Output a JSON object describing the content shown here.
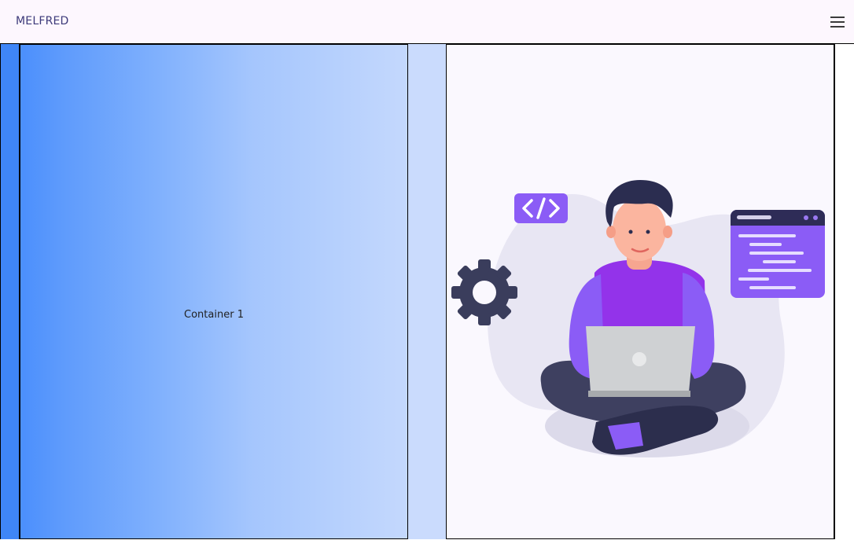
{
  "navbar": {
    "brand": "MELFRED",
    "menu_icon": "hamburger-menu-icon"
  },
  "main": {
    "container1_label": "Container 1",
    "illustration": {
      "subject": "developer-with-laptop",
      "icons": [
        "code-tag-icon",
        "gear-icon",
        "browser-window-icon",
        "laptop-icon"
      ]
    }
  },
  "colors": {
    "brand_text": "#3d3a7a",
    "blue_start": "#4b8ffd",
    "blue_end": "#c4d8fd",
    "accent_purple": "#8b5cf6",
    "dark_navy": "#2b2d50"
  }
}
